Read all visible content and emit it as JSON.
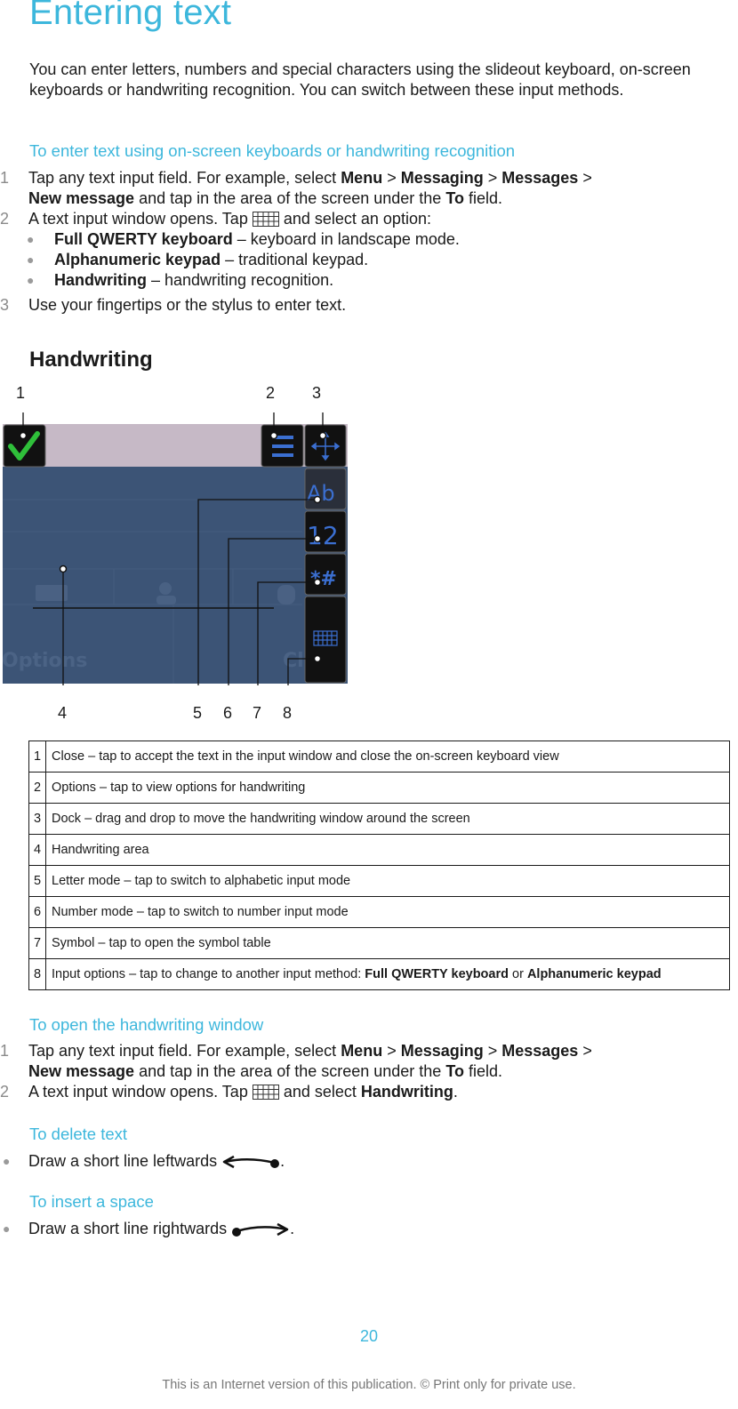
{
  "page": {
    "title": "Entering text",
    "intro": "You can enter letters, numbers and special characters using the slideout keyboard, on-screen keyboards or handwriting recognition. You can switch between these input methods.",
    "section1": {
      "heading": "To enter text using on-screen keyboards or handwriting recognition",
      "steps": [
        {
          "num": "1",
          "line1_pre": "Tap any text input field. For example, select ",
          "menu": "Menu",
          "sep": " > ",
          "messaging": "Messaging",
          "messages": "Messages",
          "line2_bold": "New message",
          "line2_mid": " and tap in the area of the screen under the ",
          "to": "To",
          "line2_end": " field."
        },
        {
          "num": "2",
          "pre": "A text input window opens. Tap ",
          "post": " and select an option:"
        },
        {
          "num": "3",
          "text": "Use your fingertips or the stylus to enter text."
        }
      ],
      "options": [
        {
          "bold": "Full QWERTY keyboard",
          "rest": " – keyboard in landscape mode."
        },
        {
          "bold": "Alphanumeric keypad",
          "rest": " – traditional keypad."
        },
        {
          "bold": "Handwriting",
          "rest": " – handwriting recognition."
        }
      ]
    },
    "handwriting_heading": "Handwriting",
    "figure": {
      "callouts": [
        "1",
        "2",
        "3",
        "4",
        "5",
        "6",
        "7",
        "8"
      ],
      "mode_labels": {
        "letter": "Ab",
        "number": "12",
        "symbol": "*#"
      },
      "background_label": "Options"
    },
    "legend": [
      {
        "n": "1",
        "text": "Close – tap to accept the text in the input window and close the on-screen keyboard view"
      },
      {
        "n": "2",
        "text": "Options – tap to view options for handwriting"
      },
      {
        "n": "3",
        "text": "Dock – drag and drop to move the handwriting window around the screen"
      },
      {
        "n": "4",
        "text": "Handwriting area"
      },
      {
        "n": "5",
        "text": "Letter mode – tap to switch to alphabetic input mode"
      },
      {
        "n": "6",
        "text": "Number mode – tap to switch to number input mode"
      },
      {
        "n": "7",
        "text": "Symbol – tap to open the symbol table"
      },
      {
        "n": "8",
        "pre": "Input options – tap to change to another input method: ",
        "b1": "Full QWERTY keyboard",
        "mid": " or ",
        "b2": "Alphanumeric keypad"
      }
    ],
    "section2": {
      "heading": "To open the handwriting window",
      "step2_pre": "A text input window opens. Tap ",
      "step2_mid": " and select ",
      "step2_bold": "Handwriting",
      "step2_end": "."
    },
    "section3": {
      "heading": "To delete text",
      "text": "Draw a short line leftwards ",
      "end": "."
    },
    "section4": {
      "heading": "To insert a space",
      "text": "Draw a short line rightwards ",
      "end": "."
    },
    "footer": {
      "page_number": "20",
      "note": "This is an Internet version of this publication. © Print only for private use."
    }
  },
  "colors": {
    "accent": "#3db7dc",
    "text": "#1a1a1a",
    "muted": "#8a8a8a"
  }
}
